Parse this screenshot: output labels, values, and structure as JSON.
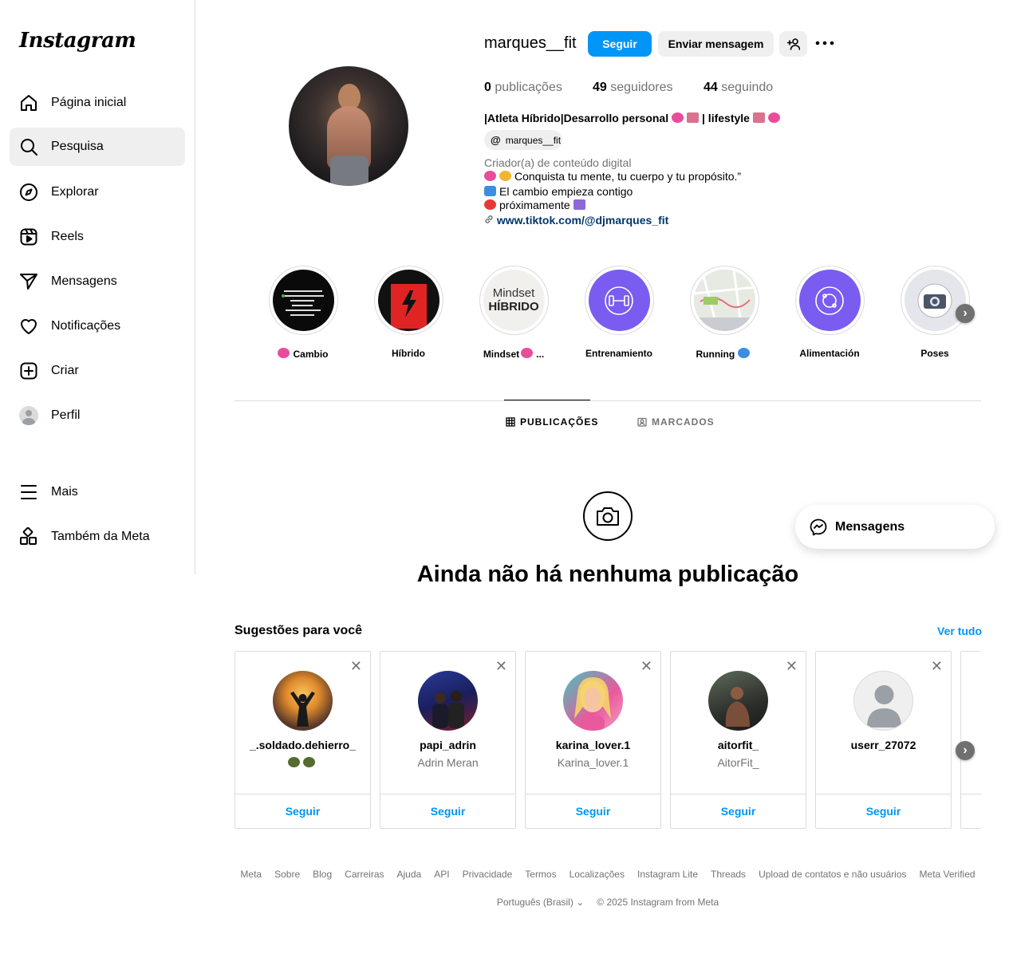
{
  "sidebar": {
    "logo": "Instagram",
    "items": [
      {
        "label": "Página inicial"
      },
      {
        "label": "Pesquisa"
      },
      {
        "label": "Explorar"
      },
      {
        "label": "Reels"
      },
      {
        "label": "Mensagens"
      },
      {
        "label": "Notificações"
      },
      {
        "label": "Criar"
      },
      {
        "label": "Perfil"
      },
      {
        "label": "Mais"
      },
      {
        "label": "Também da Meta"
      }
    ],
    "active": "Pesquisa"
  },
  "profile": {
    "username": "marques__fit",
    "follow_label": "Seguir",
    "message_label": "Enviar mensagem",
    "more_icon": "more-horizontal-icon",
    "stats": {
      "posts_count": "0",
      "posts_label": " publicações",
      "followers_count": "49",
      "followers_label": " seguidores",
      "following_count": "44",
      "following_label": " seguindo"
    },
    "bio_name": "|Atleta Híbrido|Desarrollo personal",
    "bio_name_tail": "| lifestyle",
    "threads_handle": "marques__fit",
    "category": "Criador(a) de conteúdo digital",
    "bio_lines": [
      "Conquista tu mente, tu cuerpo y tu propósito.”",
      "El cambio empieza contigo",
      "próximamente"
    ],
    "link": "www.tiktok.com/@djmarques_fit"
  },
  "highlights": [
    {
      "label": "Cambio"
    },
    {
      "label": "Híbrido"
    },
    {
      "label": "Mindset",
      "cover_text_1": "Mindset",
      "cover_text_2": "HÍBRIDO"
    },
    {
      "label": "Entrenamiento"
    },
    {
      "label": "Running"
    },
    {
      "label": "Alimentación"
    },
    {
      "label": "Poses"
    }
  ],
  "tabs": [
    {
      "label": "PUBLICAÇÕES",
      "active": true
    },
    {
      "label": "MARCADOS",
      "active": false
    }
  ],
  "empty_state": {
    "title": "Ainda não há nenhuma publicação"
  },
  "floating_messages": {
    "label": "Mensagens"
  },
  "suggestions": {
    "title": "Sugestões para você",
    "see_all": "Ver tudo",
    "follow_label": "Seguir",
    "cards": [
      {
        "username": "_.soldado.dehierro_",
        "subtitle": ""
      },
      {
        "username": "papi_adrin",
        "subtitle": "Adrin Meran"
      },
      {
        "username": "karina_lover.1",
        "subtitle": "Karina_lover.1"
      },
      {
        "username": "aitorfit_",
        "subtitle": "AitorFit_"
      },
      {
        "username": "userr_27072",
        "subtitle": ""
      }
    ]
  },
  "footer": {
    "links": [
      "Meta",
      "Sobre",
      "Blog",
      "Carreiras",
      "Ajuda",
      "API",
      "Privacidade",
      "Termos",
      "Localizações",
      "Instagram Lite",
      "Threads",
      "Upload de contatos e não usuários",
      "Meta Verified"
    ],
    "language": "Português (Brasil)",
    "copyright": "© 2025 Instagram from Meta"
  },
  "colors": {
    "accent": "#0095f6",
    "link": "#00376b",
    "muted": "#737373",
    "highlight_purple": "#7b5cf0"
  }
}
